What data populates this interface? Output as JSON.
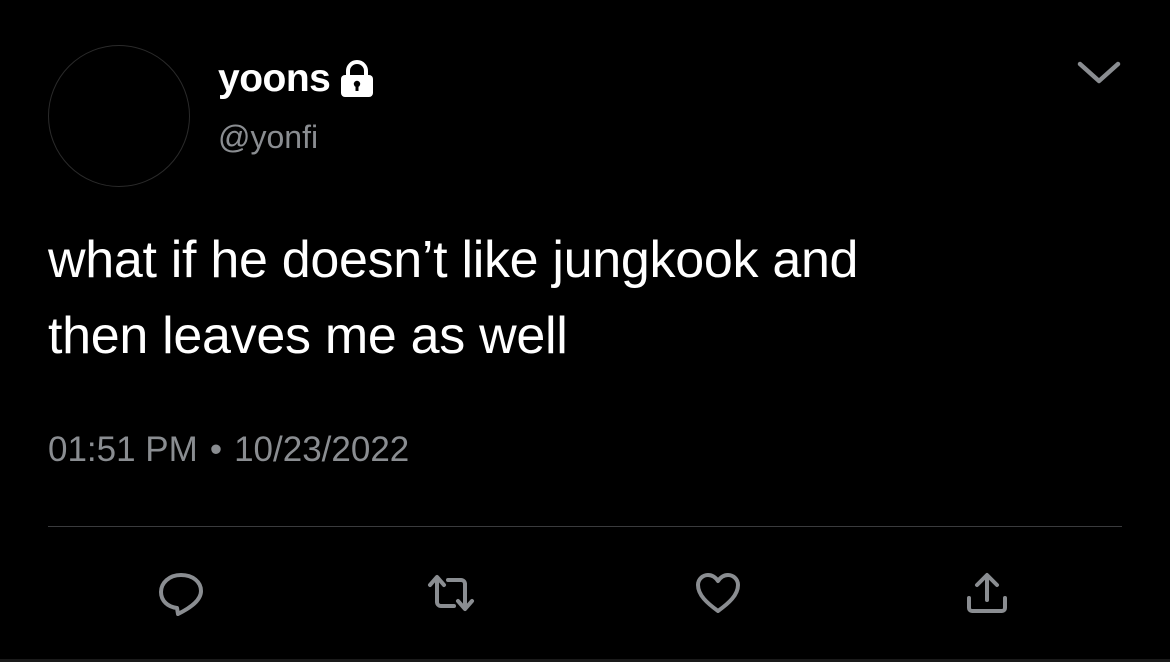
{
  "tweet": {
    "display_name": "yoons",
    "handle": "@yonfi",
    "text_line_1": "what if he doesn’t like jungkook and",
    "text_line_2": "then leaves me as well",
    "time": "01:51 PM",
    "separator": "•",
    "date": "10/23/2022"
  },
  "icons": {
    "lock": "lock-icon",
    "more": "chevron-down-icon",
    "reply": "reply-icon",
    "retweet": "retweet-icon",
    "like": "heart-icon",
    "share": "share-icon"
  },
  "colors": {
    "background": "#000000",
    "text": "#ffffff",
    "secondary": "#8a8d91",
    "icon": "#8a8d91"
  }
}
